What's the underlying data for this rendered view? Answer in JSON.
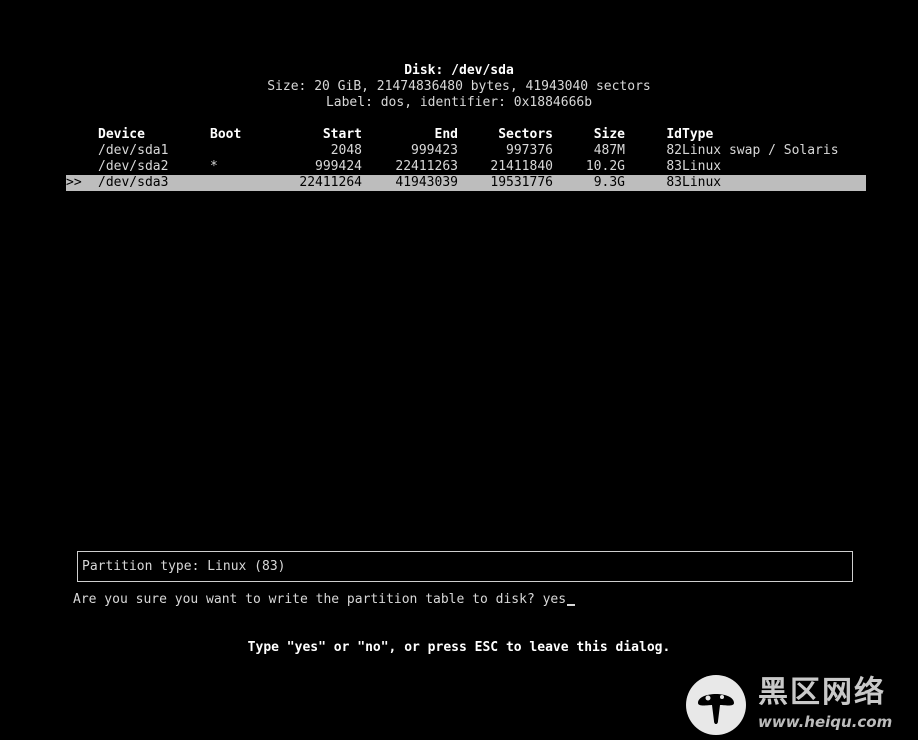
{
  "disk": {
    "title": "Disk: /dev/sda",
    "size_line": "Size: 20 GiB, 21474836480 bytes, 41943040 sectors",
    "label_line": "Label: dos, identifier: 0x1884666b"
  },
  "table": {
    "headers": {
      "device": "Device",
      "boot": "Boot",
      "start": "Start",
      "end": "End",
      "sectors": "Sectors",
      "size": "Size",
      "id": "Id",
      "type": "Type"
    },
    "rows": [
      {
        "selector": "",
        "device": "/dev/sda1",
        "boot": "",
        "start": "2048",
        "end": "999423",
        "sectors": "997376",
        "size": "487M",
        "id": "82",
        "type": "Linux swap / Solaris"
      },
      {
        "selector": "",
        "device": "/dev/sda2",
        "boot": "*",
        "start": "999424",
        "end": "22411263",
        "sectors": "21411840",
        "size": "10.2G",
        "id": "83",
        "type": "Linux"
      },
      {
        "selector": ">>",
        "device": "/dev/sda3",
        "boot": "",
        "start": "22411264",
        "end": "41943039",
        "sectors": "19531776",
        "size": "9.3G",
        "id": "83",
        "type": "Linux"
      }
    ],
    "selected_index": 2
  },
  "info": {
    "partition_type": "Partition type: Linux (83)"
  },
  "prompt": {
    "question": "Are you sure you want to write the partition table to disk? ",
    "answer": "yes"
  },
  "hint": "Type \"yes\" or \"no\", or press ESC to leave this dialog.",
  "watermark": {
    "title": "黑区网络",
    "url": "www.heiqu.com"
  },
  "colors": {
    "background": "#000000",
    "text": "#d8d8d8",
    "selection": "#bdbdbd"
  }
}
